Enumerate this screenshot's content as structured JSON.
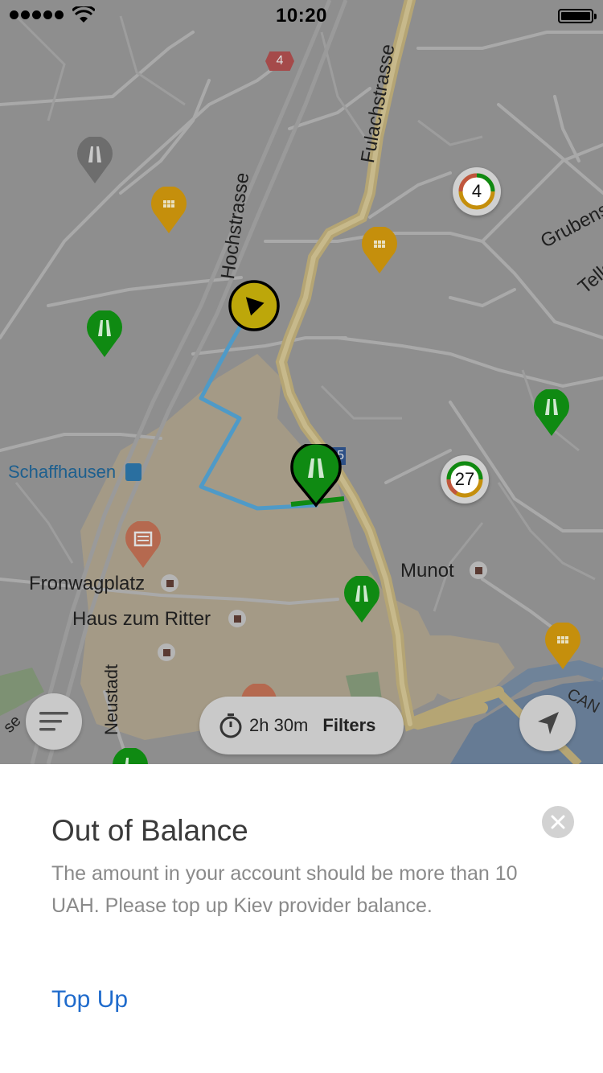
{
  "status_bar": {
    "time": "10:20"
  },
  "map": {
    "labels": {
      "fulachstrasse": "Fulachstrasse",
      "hochstrasse": "Hochstrasse",
      "grubenstrasse": "Grubenstra",
      "tellstrasse": "Tellst",
      "schaffhausen": "Schaffhausen",
      "fronwagplatz": "Fronwagplatz",
      "haus_zum_ritter": "Haus zum Ritter",
      "munot": "Munot",
      "neustadt": "Neustadt",
      "road_shield_4": "4",
      "road_shield_15": "15",
      "edge_left": "se",
      "edge_right": "CAN"
    },
    "clusters": [
      {
        "count": "4"
      },
      {
        "count": "27"
      }
    ],
    "menu_button_icon": "menu-icon",
    "locate_button_icon": "navigation-arrow-icon"
  },
  "filter_pill": {
    "timer": "2h 30m",
    "filters_label": "Filters"
  },
  "sheet": {
    "title": "Out of Balance",
    "message": "The amount in your account should be more than 10 UAH. Please top up Kiev provider balance.",
    "action": "Top Up"
  },
  "colors": {
    "parking_green": "#0f8a12",
    "parking_orange": "#c58f0c",
    "current_location_yellow": "#bda70a",
    "route_blue": "#4f9ac7",
    "link_blue": "#1f6bcc"
  }
}
